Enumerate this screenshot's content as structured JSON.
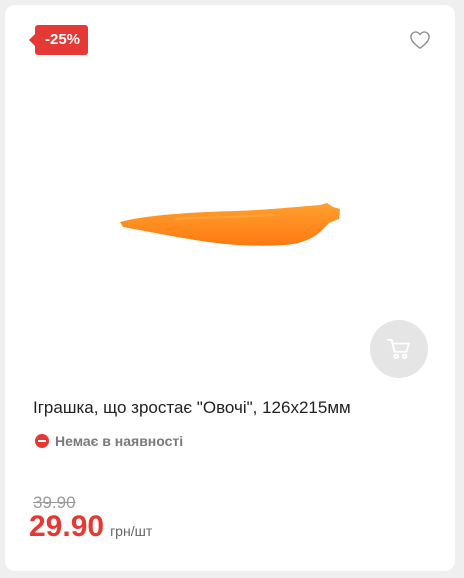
{
  "product": {
    "discount_badge": "-25%",
    "title": "Іграшка, що зростає \"Овочі\", 126x215мм",
    "availability": "Немає в наявності",
    "old_price": "39.90",
    "price": "29.90",
    "unit": "грн/шт"
  },
  "icons": {
    "favorite": "heart-outline-icon",
    "cart": "shopping-cart-icon",
    "status": "minus-circle-icon"
  },
  "colors": {
    "accent": "#e53935",
    "cart_button_bg": "#e5e5e5",
    "product_orange": "#ff8c1a"
  }
}
